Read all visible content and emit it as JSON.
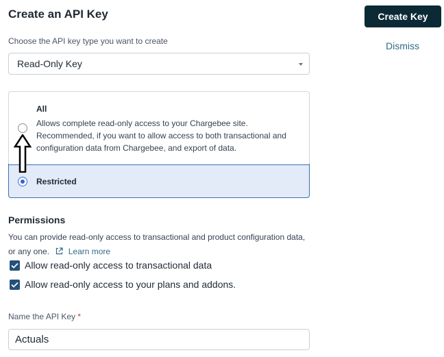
{
  "header": {
    "title": "Create an API Key",
    "create_button": "Create Key",
    "dismiss_link": "Dismiss"
  },
  "key_type": {
    "label": "Choose the API key type you want to create",
    "selected": "Read-Only Key"
  },
  "access_options": [
    {
      "label": "All",
      "description": "Allows complete read-only access to your Chargebee site. Recommended, if you want to allow access to both transactional and configuration data from Chargebee, and export of data.",
      "selected": false
    },
    {
      "label": "Restricted",
      "selected": true
    }
  ],
  "permissions": {
    "title": "Permissions",
    "description": "You can provide read-only access to transactional and product configuration data, or any one.",
    "learn_more": "Learn more",
    "checkboxes": [
      {
        "label": "Allow read-only access to transactional data",
        "checked": true
      },
      {
        "label": "Allow read-only access to your plans and addons.",
        "checked": true
      }
    ]
  },
  "name_field": {
    "label": "Name the API Key",
    "required_marker": "*",
    "value": "Actuals"
  },
  "colors": {
    "primary_button": "#0b2a35",
    "link": "#2f6b87",
    "selected_bg": "#e3eaf8",
    "checkbox": "#25507a"
  }
}
